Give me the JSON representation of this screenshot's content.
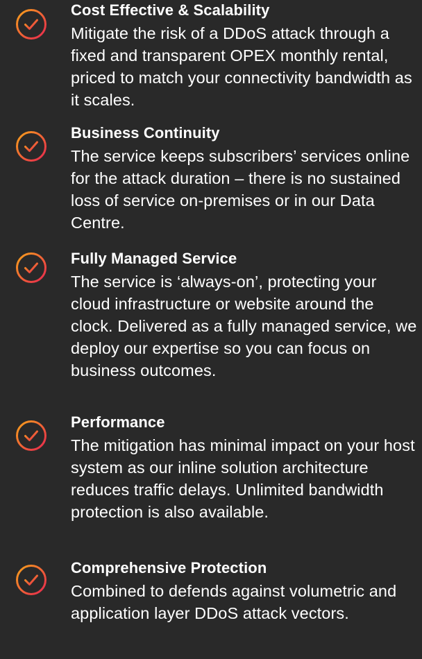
{
  "features": [
    {
      "icon": "check-circle-icon",
      "title": "Cost Effective & Scalability",
      "description": "Mitigate the risk of a DDoS attack through a fixed and transparent OPEX monthly rental, priced to match your connectivity bandwidth as it scales."
    },
    {
      "icon": "check-circle-icon",
      "title": "Business Continuity",
      "description": "The service keeps subscribers’ services online for the attack duration – there is no sustained loss of service on-premises or in our Data Centre."
    },
    {
      "icon": "check-circle-icon",
      "title": "Fully Managed Service",
      "description": "The service is ‘always-on’, protecting your cloud infrastructure or website around the clock. Delivered as a fully managed service, we deploy our expertise so you can focus on business outcomes."
    },
    {
      "icon": "check-circle-icon",
      "title": "Performance",
      "description": "The mitigation has minimal impact on your host system as our inline solution architecture reduces traffic delays. Unlimited bandwidth protection is also available."
    },
    {
      "icon": "check-circle-icon",
      "title": "Comprehensive Protection",
      "description": "Combined to defends against volumetric and application layer DDoS attack vectors."
    }
  ],
  "colors": {
    "background": "#292929",
    "text": "#ffffff",
    "icon_gradient_start": "#f7a21b",
    "icon_gradient_end": "#e8264f"
  }
}
